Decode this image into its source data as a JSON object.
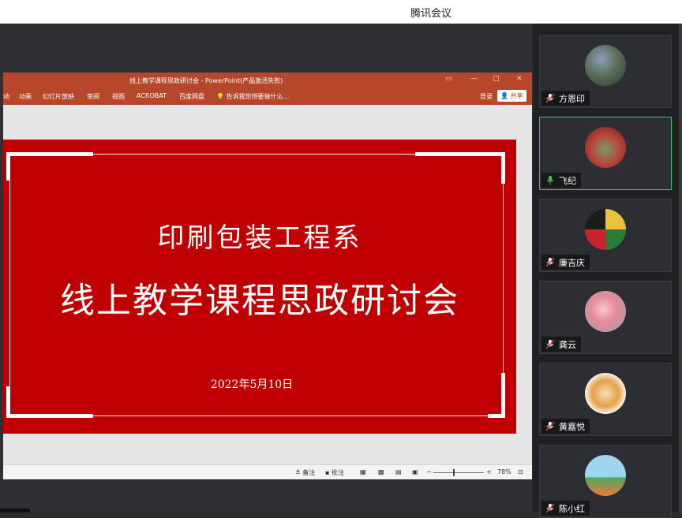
{
  "app": {
    "title": "腾讯会议"
  },
  "ppt": {
    "window_title": "线上教学课程思政研讨会 - PowerPoint(产品激活失败)",
    "tabs": [
      "动画",
      "幻灯片放映",
      "审阅",
      "视图",
      "ACROBAT",
      "百度网盘"
    ],
    "search_hint": "告诉我您想要做什么...",
    "login": "登录",
    "share": "共享",
    "status": {
      "notes": "备注",
      "comments": "批注",
      "zoom": "78%"
    }
  },
  "slide": {
    "line1": "印刷包装工程系",
    "line2": "线上教学课程思政研讨会",
    "date": "2022年5月10日",
    "bg_color": "#c00000"
  },
  "participants": [
    {
      "name": "方恩印",
      "mic": "muted"
    },
    {
      "name": "飞纪",
      "mic": "speaking"
    },
    {
      "name": "廉吉庆",
      "mic": "muted"
    },
    {
      "name": "龚云",
      "mic": "muted"
    },
    {
      "name": "黄嘉悦",
      "mic": "muted"
    },
    {
      "name": "陈小红",
      "mic": "muted"
    }
  ],
  "colors": {
    "accent_green": "#3cc062",
    "ppt_red": "#b7472a"
  }
}
